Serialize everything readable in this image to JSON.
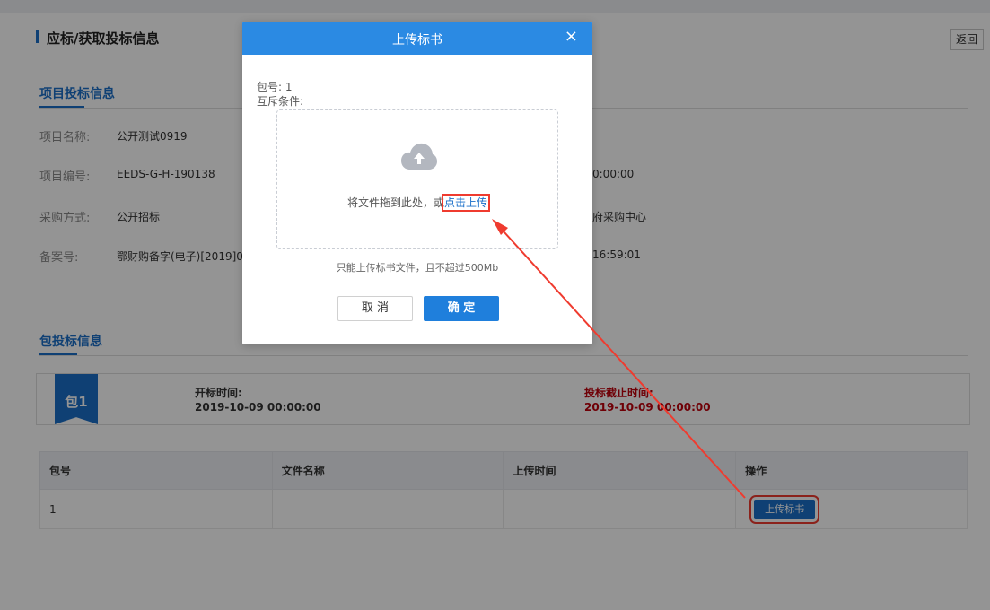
{
  "header": {
    "title": "应标/获取投标信息",
    "back_label": "返回"
  },
  "project_section": {
    "title": "项目投标信息",
    "fields": [
      {
        "label": "项目名称:",
        "value": "公开测试0919"
      },
      {
        "label": "项目编号:",
        "value": "EEDS-G-H-190138"
      },
      {
        "label": "采购方式:",
        "value": "公开招标"
      },
      {
        "label": "备案号:",
        "value": "鄂财购备字(电子)[2019]0"
      }
    ],
    "right_values": [
      "0:00:00",
      "府采购中心",
      "16:59:01"
    ]
  },
  "package_section": {
    "title": "包投标信息",
    "package_badge": "包1",
    "open_time_label": "开标时间:",
    "open_time_value": "2019-10-09 00:00:00",
    "deadline_label": "投标截止时间:",
    "deadline_value": "2019-10-09 00:00:00"
  },
  "table": {
    "headers": [
      "包号",
      "文件名称",
      "上传时间",
      "操作"
    ],
    "rows": [
      {
        "package_no": "1",
        "file_name": "",
        "upload_time": "",
        "action_label": "上传标书"
      }
    ]
  },
  "modal": {
    "title": "上传标书",
    "close_glyph": "×",
    "package_line": "包号: 1",
    "exclusive_line": "互斥条件:",
    "drop_text": "将文件拖到此处，或",
    "drop_link": "点击上传",
    "tip": "只能上传标书文件，且不超过500Mb",
    "cancel_label": "取 消",
    "confirm_label": "确 定"
  },
  "colors": {
    "primary": "#1a6fc9",
    "modal_header": "#2b8ae3",
    "deadline_red": "#c0000c",
    "annotation_red": "#ef3b2f"
  },
  "icons": [
    "cloud-upload-icon",
    "close-icon"
  ]
}
